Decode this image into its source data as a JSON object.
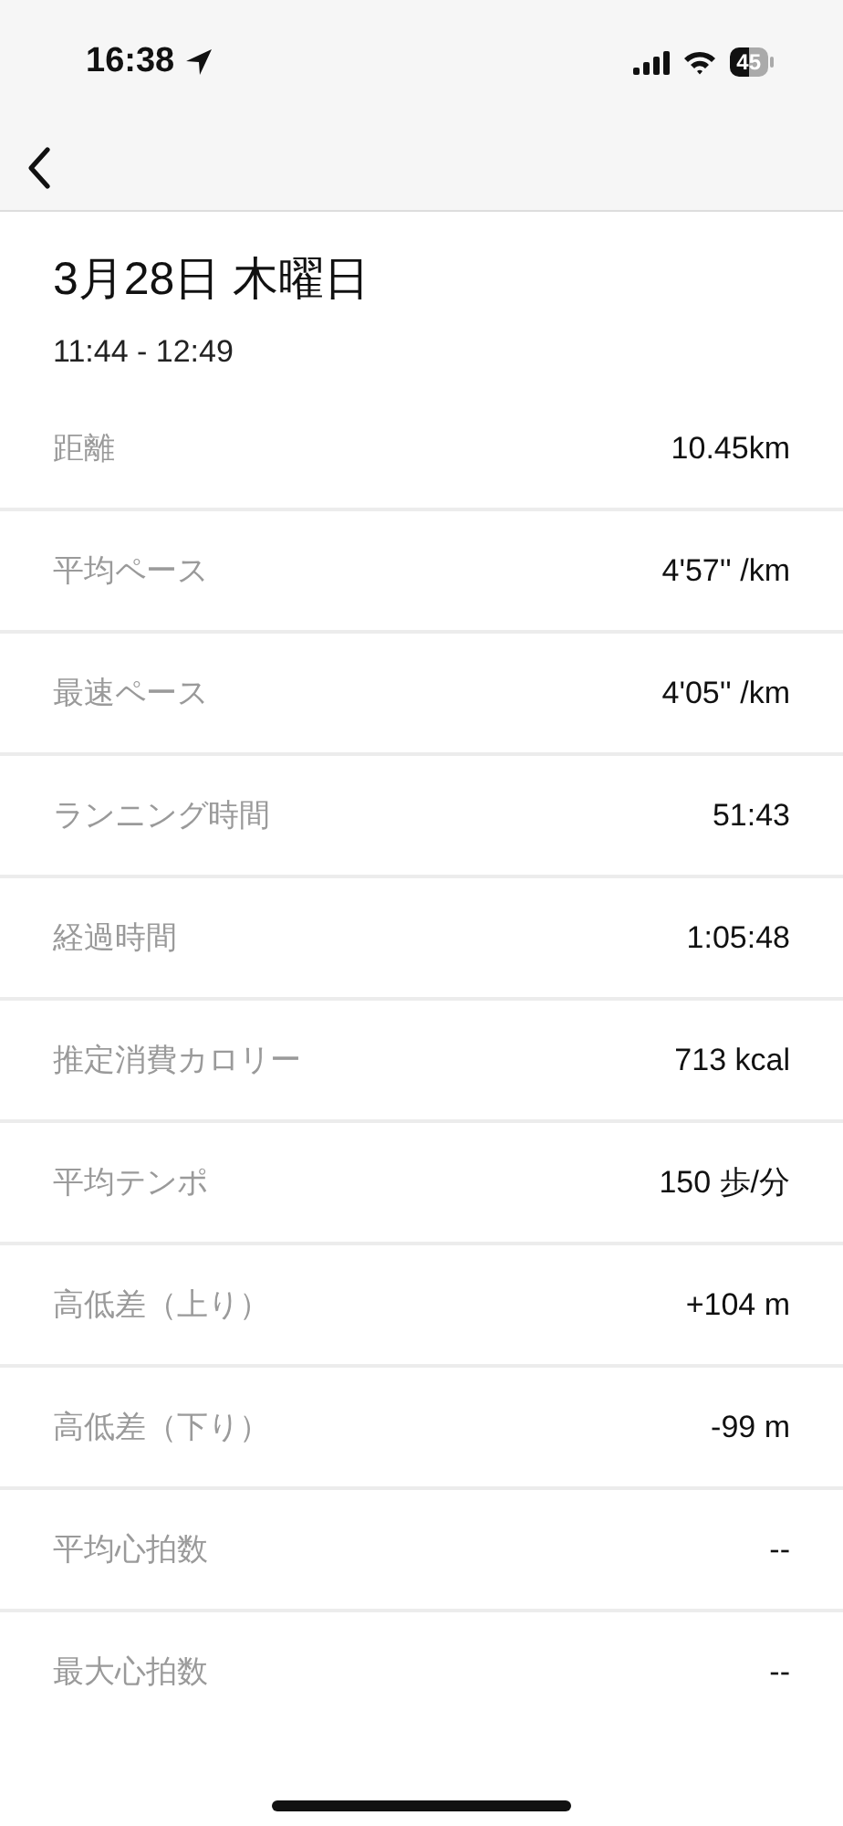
{
  "status_bar": {
    "time": "16:38",
    "battery": "45"
  },
  "header": {
    "title": "3月28日 木曜日",
    "time_range": "11:44 - 12:49"
  },
  "stats": [
    {
      "label": "距離",
      "value": "10.45km"
    },
    {
      "label": "平均ペース",
      "value": "4'57'' /km"
    },
    {
      "label": "最速ペース",
      "value": "4'05'' /km"
    },
    {
      "label": "ランニング時間",
      "value": "51:43"
    },
    {
      "label": "経過時間",
      "value": "1:05:48"
    },
    {
      "label": "推定消費カロリー",
      "value": "713 kcal"
    },
    {
      "label": "平均テンポ",
      "value": "150 歩/分"
    },
    {
      "label": "高低差（上り）",
      "value": "+104 m"
    },
    {
      "label": "高低差（下り）",
      "value": "-99 m"
    },
    {
      "label": "平均心拍数",
      "value": "--"
    },
    {
      "label": "最大心拍数",
      "value": "--"
    }
  ]
}
